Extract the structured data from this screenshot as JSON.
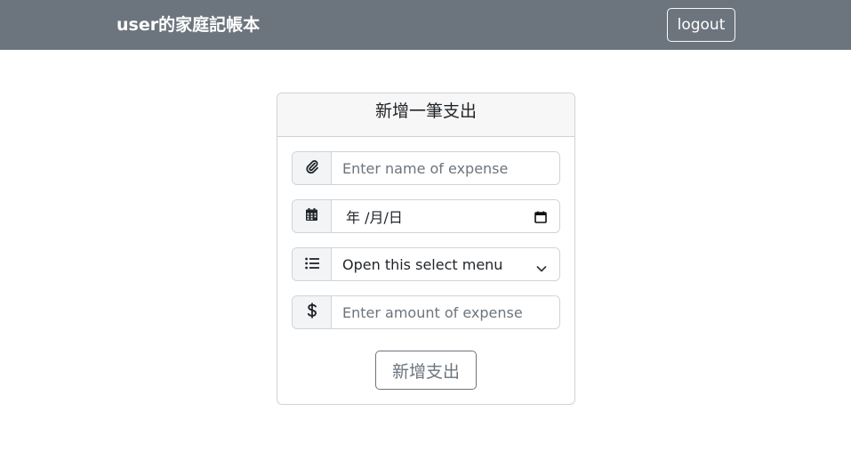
{
  "navbar": {
    "brand": "user的家庭記帳本",
    "logout_label": "logout"
  },
  "card": {
    "title": "新增一筆支出",
    "fields": {
      "name": {
        "icon": "paperclip-icon",
        "placeholder": "Enter name of expense"
      },
      "date": {
        "icon": "calendar-icon",
        "value": "年 /月/日",
        "picker_icon": "calendar-picker-icon"
      },
      "category": {
        "icon": "list-icon",
        "selected": "Open this select menu",
        "chevron_icon": "chevron-down-icon"
      },
      "amount": {
        "icon": "dollar-icon",
        "placeholder": "Enter amount of expense"
      }
    },
    "submit_label": "新增支出"
  },
  "colors": {
    "navbar_bg": "#6c757d",
    "addon_bg": "#f3f4f6",
    "border": "#ced4da",
    "placeholder": "#6c757d"
  }
}
